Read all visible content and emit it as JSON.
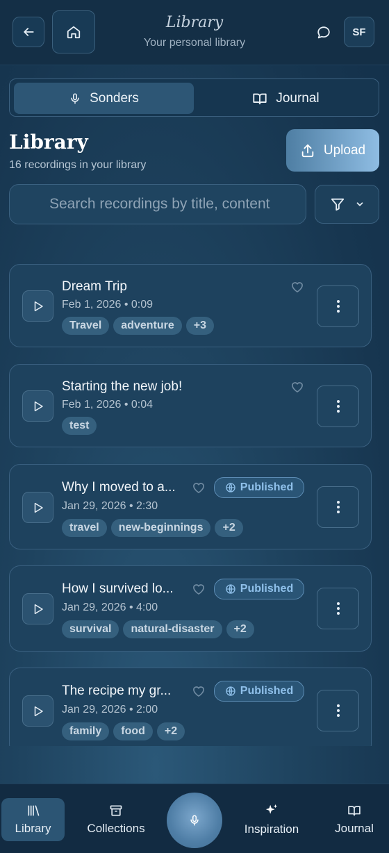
{
  "header": {
    "title": "Library",
    "subtitle": "Your personal library",
    "avatar_initials": "SF",
    "icons": [
      "back-arrow-icon",
      "home-icon",
      "chat-bubble-icon"
    ]
  },
  "segmented": {
    "tabs": [
      {
        "label": "Sonders",
        "icon": "microphone-icon",
        "active": true
      },
      {
        "label": "Journal",
        "icon": "open-book-icon",
        "active": false
      }
    ]
  },
  "page": {
    "title": "Library",
    "subtitle": "16 recordings in your library",
    "upload_label": "Upload"
  },
  "search": {
    "placeholder": "Search recordings by title, content"
  },
  "recordings": [
    {
      "title": "Dream Trip",
      "meta": "Feb 1, 2026 • 0:09",
      "tags": [
        "Travel",
        "adventure",
        "+3"
      ],
      "published": false
    },
    {
      "title": "Starting the new job!",
      "meta": "Feb 1, 2026 • 0:04",
      "tags": [
        "test"
      ],
      "published": false
    },
    {
      "title": "Why I moved to a...",
      "meta": "Jan 29, 2026 • 2:30",
      "tags": [
        "travel",
        "new-beginnings",
        "+2"
      ],
      "published": true,
      "published_label": "Published"
    },
    {
      "title": "How I survived lo...",
      "meta": "Jan 29, 2026 • 4:00",
      "tags": [
        "survival",
        "natural-disaster",
        "+2"
      ],
      "published": true,
      "published_label": "Published"
    },
    {
      "title": "The recipe my gr...",
      "meta": "Jan 29, 2026 • 2:00",
      "tags": [
        "family",
        "food",
        "+2"
      ],
      "published": true,
      "published_label": "Published"
    }
  ],
  "bottom_nav": {
    "items": [
      {
        "label": "Library",
        "icon": "library-icon",
        "active": true
      },
      {
        "label": "Collections",
        "icon": "archive-box-icon",
        "active": false
      },
      {
        "label": "Inspiration",
        "icon": "sparkles-icon",
        "active": false
      },
      {
        "label": "Journal",
        "icon": "open-book-icon",
        "active": false
      }
    ]
  },
  "colors": {
    "background": "#1a3a55",
    "accent": "#8fbde3",
    "published": "#8fc0ea"
  }
}
